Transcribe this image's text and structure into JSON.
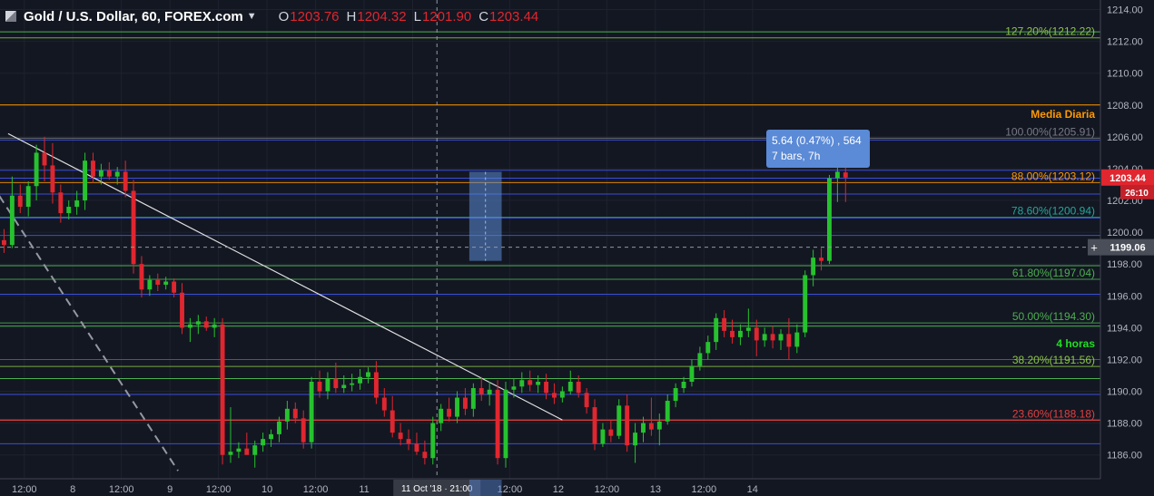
{
  "legend": {
    "symbol": "Gold / U.S. Dollar, 60, FOREX.com",
    "open_key": "O",
    "open": "1203.76",
    "high_key": "H",
    "high": "1204.32",
    "low_key": "L",
    "low": "1201.90",
    "close_key": "C",
    "close": "1203.44"
  },
  "measure_tooltip": {
    "line1": "5.64 (0.47%) , 564",
    "line2": "7 bars, 7h"
  },
  "chart_data": {
    "type": "candlestick",
    "symbol": "Gold / U.S. Dollar",
    "interval": "60",
    "source": "FOREX.com",
    "y_axis": {
      "range": [
        1184.5,
        1214.6
      ],
      "ticks": [
        1186,
        1188,
        1190,
        1192,
        1194,
        1196,
        1198,
        1200,
        1202,
        1204,
        1206,
        1208,
        1210,
        1212,
        1214
      ],
      "labels": [
        "1186.00",
        "1188.00",
        "1190.00",
        "1192.00",
        "1194.00",
        "1196.00",
        "1198.00",
        "1200.00",
        "1202.00",
        "1204.00",
        "1206.00",
        "1208.00",
        "1210.00",
        "1212.00",
        "1214.00"
      ]
    },
    "x_axis": {
      "range": [
        0,
        136
      ],
      "ticks": [
        {
          "x": 3,
          "label": "12:00"
        },
        {
          "x": 9,
          "label": "8"
        },
        {
          "x": 15,
          "label": "12:00"
        },
        {
          "x": 21,
          "label": "9"
        },
        {
          "x": 27,
          "label": "12:00"
        },
        {
          "x": 33,
          "label": "10"
        },
        {
          "x": 39,
          "label": "12:00"
        },
        {
          "x": 45,
          "label": "11"
        },
        {
          "x": 51,
          "label": "12:00"
        },
        {
          "x": 63,
          "label": "12:00"
        },
        {
          "x": 69,
          "label": "12"
        },
        {
          "x": 75,
          "label": "12:00"
        },
        {
          "x": 81,
          "label": "13"
        },
        {
          "x": 87,
          "label": "12:00"
        },
        {
          "x": 93,
          "label": "14"
        }
      ],
      "crosshair_label": "11 Oct '18 · 21:00"
    },
    "fib_levels": [
      {
        "label": "127.20%(1212.22)",
        "price": 1212.22,
        "color": "#8bc34a"
      },
      {
        "label": "100.00%(1205.91)",
        "price": 1205.91,
        "color": "#787b86"
      },
      {
        "label": "88.00%(1203.12)",
        "price": 1203.12,
        "color": "#ff9800"
      },
      {
        "label": "78.60%(1200.94)",
        "price": 1200.94,
        "color": "#26a69a"
      },
      {
        "label": "61.80%(1197.04)",
        "price": 1197.04,
        "color": "#4caf50"
      },
      {
        "label": "50.00%(1194.30)",
        "price": 1194.3,
        "color": "#4caf50"
      },
      {
        "label": "38.20%(1191.56)",
        "price": 1191.56,
        "color": "#8bc34a"
      },
      {
        "label": "23.60%(1188.18)",
        "price": 1188.18,
        "color": "#e04040"
      }
    ],
    "extra_lines": [
      {
        "price": 1212.6,
        "color": "#4caf50"
      },
      {
        "price": 1205.8,
        "color": "#3b4ed8"
      },
      {
        "price": 1203.9,
        "color": "#3b4ed8"
      },
      {
        "price": 1203.4,
        "color": "#3b4ed8"
      },
      {
        "price": 1202.4,
        "color": "#3b4ed8"
      },
      {
        "price": 1200.9,
        "color": "#3b4ed8"
      },
      {
        "price": 1199.8,
        "color": "#3b4ed8"
      },
      {
        "price": 1197.9,
        "color": "#4caf50"
      },
      {
        "price": 1196.1,
        "color": "#3b4ed8"
      },
      {
        "price": 1194.1,
        "color": "#4caf50"
      },
      {
        "price": 1192.0,
        "color": "#3b4ed8"
      },
      {
        "price": 1190.8,
        "color": "#4caf50"
      },
      {
        "price": 1189.8,
        "color": "#3b4ed8"
      },
      {
        "price": 1188.2,
        "color": "#e04040"
      },
      {
        "price": 1186.7,
        "color": "#3b4ed8"
      }
    ],
    "media_diaria": {
      "label": "Media Diaria",
      "price": 1208.0,
      "color": "#ff9800"
    },
    "cuatro_horas": {
      "label": "4 horas",
      "price": 1193.8,
      "color": "#22dd22"
    },
    "trendline": {
      "from": [
        1,
        1206.2
      ],
      "to": [
        69.5,
        1188.2
      ],
      "color": "#e0e0e0"
    },
    "dashed_trendline": {
      "from": [
        -1,
        1203.0
      ],
      "to": [
        22,
        1185.0
      ],
      "color": "#9598a1"
    },
    "measure_box": {
      "from": [
        58,
        1198.2
      ],
      "to": [
        62,
        1203.8
      ]
    },
    "crosshair": {
      "x": 54,
      "price": 1199.06,
      "label": "1199.06"
    },
    "current_price": {
      "price": 1203.44,
      "label": "1203.44",
      "countdown": "26:10"
    },
    "candles": [
      {
        "o": 1199.5,
        "h": 1200.2,
        "l": 1198.7,
        "c": 1199.2
      },
      {
        "o": 1199.2,
        "h": 1203.5,
        "l": 1199.0,
        "c": 1202.3
      },
      {
        "o": 1202.3,
        "h": 1203.0,
        "l": 1201.2,
        "c": 1201.6
      },
      {
        "o": 1201.6,
        "h": 1203.2,
        "l": 1201.0,
        "c": 1202.9
      },
      {
        "o": 1202.9,
        "h": 1205.5,
        "l": 1202.0,
        "c": 1205.0
      },
      {
        "o": 1205.0,
        "h": 1206.0,
        "l": 1203.2,
        "c": 1204.2
      },
      {
        "o": 1204.2,
        "h": 1205.6,
        "l": 1201.8,
        "c": 1202.5
      },
      {
        "o": 1202.5,
        "h": 1203.0,
        "l": 1200.6,
        "c": 1201.2
      },
      {
        "o": 1201.2,
        "h": 1202.0,
        "l": 1200.8,
        "c": 1201.6
      },
      {
        "o": 1201.6,
        "h": 1202.6,
        "l": 1201.1,
        "c": 1202.0
      },
      {
        "o": 1202.0,
        "h": 1205.0,
        "l": 1201.4,
        "c": 1204.5
      },
      {
        "o": 1204.5,
        "h": 1205.0,
        "l": 1203.1,
        "c": 1203.5
      },
      {
        "o": 1203.5,
        "h": 1204.3,
        "l": 1203.0,
        "c": 1203.9
      },
      {
        "o": 1203.9,
        "h": 1204.4,
        "l": 1203.3,
        "c": 1203.5
      },
      {
        "o": 1203.5,
        "h": 1204.1,
        "l": 1203.0,
        "c": 1203.8
      },
      {
        "o": 1203.8,
        "h": 1204.5,
        "l": 1202.2,
        "c": 1202.6
      },
      {
        "o": 1202.6,
        "h": 1203.3,
        "l": 1197.4,
        "c": 1198.0
      },
      {
        "o": 1198.0,
        "h": 1198.5,
        "l": 1195.9,
        "c": 1196.4
      },
      {
        "o": 1196.4,
        "h": 1197.3,
        "l": 1196.0,
        "c": 1197.0
      },
      {
        "o": 1197.0,
        "h": 1197.4,
        "l": 1196.3,
        "c": 1196.7
      },
      {
        "o": 1196.7,
        "h": 1197.2,
        "l": 1196.4,
        "c": 1196.9
      },
      {
        "o": 1196.9,
        "h": 1197.1,
        "l": 1195.9,
        "c": 1196.2
      },
      {
        "o": 1196.2,
        "h": 1196.8,
        "l": 1193.6,
        "c": 1194.0
      },
      {
        "o": 1194.0,
        "h": 1194.6,
        "l": 1193.1,
        "c": 1194.2
      },
      {
        "o": 1194.2,
        "h": 1194.8,
        "l": 1193.6,
        "c": 1194.4
      },
      {
        "o": 1194.4,
        "h": 1194.7,
        "l": 1193.8,
        "c": 1194.0
      },
      {
        "o": 1194.0,
        "h": 1194.6,
        "l": 1193.4,
        "c": 1194.2
      },
      {
        "o": 1194.2,
        "h": 1194.6,
        "l": 1185.4,
        "c": 1186.0
      },
      {
        "o": 1186.0,
        "h": 1189.0,
        "l": 1185.5,
        "c": 1186.2
      },
      {
        "o": 1186.2,
        "h": 1186.8,
        "l": 1185.8,
        "c": 1186.4
      },
      {
        "o": 1186.4,
        "h": 1187.4,
        "l": 1186.0,
        "c": 1186.0
      },
      {
        "o": 1186.0,
        "h": 1186.9,
        "l": 1185.2,
        "c": 1186.6
      },
      {
        "o": 1186.6,
        "h": 1187.4,
        "l": 1186.2,
        "c": 1187.0
      },
      {
        "o": 1187.0,
        "h": 1187.6,
        "l": 1186.5,
        "c": 1187.3
      },
      {
        "o": 1187.3,
        "h": 1188.4,
        "l": 1186.8,
        "c": 1188.1
      },
      {
        "o": 1188.1,
        "h": 1189.4,
        "l": 1187.6,
        "c": 1188.9
      },
      {
        "o": 1188.9,
        "h": 1189.3,
        "l": 1188.0,
        "c": 1188.3
      },
      {
        "o": 1188.3,
        "h": 1188.8,
        "l": 1186.4,
        "c": 1186.8
      },
      {
        "o": 1186.8,
        "h": 1190.9,
        "l": 1186.4,
        "c": 1190.6
      },
      {
        "o": 1190.6,
        "h": 1191.3,
        "l": 1189.6,
        "c": 1190.0
      },
      {
        "o": 1190.0,
        "h": 1191.2,
        "l": 1189.5,
        "c": 1190.8
      },
      {
        "o": 1190.8,
        "h": 1191.8,
        "l": 1189.9,
        "c": 1190.2
      },
      {
        "o": 1190.2,
        "h": 1191.0,
        "l": 1189.9,
        "c": 1190.4
      },
      {
        "o": 1190.4,
        "h": 1191.1,
        "l": 1190.0,
        "c": 1190.5
      },
      {
        "o": 1190.5,
        "h": 1191.4,
        "l": 1190.1,
        "c": 1190.9
      },
      {
        "o": 1190.9,
        "h": 1191.5,
        "l": 1190.5,
        "c": 1191.2
      },
      {
        "o": 1191.2,
        "h": 1191.9,
        "l": 1189.2,
        "c": 1189.6
      },
      {
        "o": 1189.6,
        "h": 1190.2,
        "l": 1188.4,
        "c": 1188.8
      },
      {
        "o": 1188.8,
        "h": 1189.7,
        "l": 1187.1,
        "c": 1187.4
      },
      {
        "o": 1187.4,
        "h": 1188.0,
        "l": 1186.6,
        "c": 1187.0
      },
      {
        "o": 1187.0,
        "h": 1187.6,
        "l": 1186.3,
        "c": 1186.7
      },
      {
        "o": 1186.7,
        "h": 1187.4,
        "l": 1186.0,
        "c": 1186.2
      },
      {
        "o": 1186.2,
        "h": 1186.9,
        "l": 1185.4,
        "c": 1185.8
      },
      {
        "o": 1185.8,
        "h": 1188.4,
        "l": 1185.4,
        "c": 1188.0
      },
      {
        "o": 1188.0,
        "h": 1189.2,
        "l": 1187.5,
        "c": 1188.9
      },
      {
        "o": 1188.9,
        "h": 1189.6,
        "l": 1188.1,
        "c": 1188.4
      },
      {
        "o": 1188.4,
        "h": 1190.0,
        "l": 1188.0,
        "c": 1189.6
      },
      {
        "o": 1189.6,
        "h": 1190.2,
        "l": 1188.5,
        "c": 1188.9
      },
      {
        "o": 1188.9,
        "h": 1190.5,
        "l": 1188.4,
        "c": 1190.2
      },
      {
        "o": 1190.2,
        "h": 1190.9,
        "l": 1189.4,
        "c": 1189.8
      },
      {
        "o": 1189.8,
        "h": 1190.6,
        "l": 1189.1,
        "c": 1190.1
      },
      {
        "o": 1190.1,
        "h": 1190.7,
        "l": 1185.4,
        "c": 1185.8
      },
      {
        "o": 1185.8,
        "h": 1190.6,
        "l": 1185.2,
        "c": 1190.1
      },
      {
        "o": 1190.1,
        "h": 1190.8,
        "l": 1189.6,
        "c": 1190.3
      },
      {
        "o": 1190.3,
        "h": 1191.2,
        "l": 1189.9,
        "c": 1190.7
      },
      {
        "o": 1190.7,
        "h": 1191.3,
        "l": 1190.0,
        "c": 1190.4
      },
      {
        "o": 1190.4,
        "h": 1191.0,
        "l": 1189.9,
        "c": 1190.6
      },
      {
        "o": 1190.6,
        "h": 1191.1,
        "l": 1189.5,
        "c": 1189.9
      },
      {
        "o": 1189.9,
        "h": 1190.5,
        "l": 1189.2,
        "c": 1189.6
      },
      {
        "o": 1189.6,
        "h": 1190.3,
        "l": 1189.3,
        "c": 1190.0
      },
      {
        "o": 1190.0,
        "h": 1191.3,
        "l": 1189.8,
        "c": 1190.6
      },
      {
        "o": 1190.6,
        "h": 1191.0,
        "l": 1189.6,
        "c": 1189.9
      },
      {
        "o": 1189.9,
        "h": 1190.2,
        "l": 1188.6,
        "c": 1189.0
      },
      {
        "o": 1189.0,
        "h": 1189.5,
        "l": 1186.3,
        "c": 1186.7
      },
      {
        "o": 1186.7,
        "h": 1188.0,
        "l": 1186.5,
        "c": 1187.6
      },
      {
        "o": 1187.6,
        "h": 1188.2,
        "l": 1186.8,
        "c": 1187.2
      },
      {
        "o": 1187.2,
        "h": 1189.5,
        "l": 1187.0,
        "c": 1189.1
      },
      {
        "o": 1189.1,
        "h": 1189.8,
        "l": 1186.2,
        "c": 1186.6
      },
      {
        "o": 1186.6,
        "h": 1188.0,
        "l": 1185.5,
        "c": 1187.4
      },
      {
        "o": 1187.4,
        "h": 1188.4,
        "l": 1186.8,
        "c": 1188.0
      },
      {
        "o": 1188.0,
        "h": 1189.6,
        "l": 1187.2,
        "c": 1187.6
      },
      {
        "o": 1187.6,
        "h": 1188.6,
        "l": 1186.6,
        "c": 1188.1
      },
      {
        "o": 1188.1,
        "h": 1189.8,
        "l": 1187.9,
        "c": 1189.4
      },
      {
        "o": 1189.4,
        "h": 1190.5,
        "l": 1189.0,
        "c": 1190.2
      },
      {
        "o": 1190.2,
        "h": 1190.9,
        "l": 1189.9,
        "c": 1190.6
      },
      {
        "o": 1190.6,
        "h": 1192.0,
        "l": 1190.3,
        "c": 1191.6
      },
      {
        "o": 1191.6,
        "h": 1192.8,
        "l": 1191.3,
        "c": 1192.4
      },
      {
        "o": 1192.4,
        "h": 1193.5,
        "l": 1192.0,
        "c": 1193.1
      },
      {
        "o": 1193.1,
        "h": 1194.9,
        "l": 1192.6,
        "c": 1194.6
      },
      {
        "o": 1194.6,
        "h": 1195.1,
        "l": 1193.4,
        "c": 1193.8
      },
      {
        "o": 1193.8,
        "h": 1194.5,
        "l": 1193.0,
        "c": 1193.4
      },
      {
        "o": 1193.4,
        "h": 1194.2,
        "l": 1192.9,
        "c": 1193.8
      },
      {
        "o": 1193.8,
        "h": 1195.2,
        "l": 1193.4,
        "c": 1194.0
      },
      {
        "o": 1194.0,
        "h": 1194.5,
        "l": 1192.2,
        "c": 1193.2
      },
      {
        "o": 1193.2,
        "h": 1194.0,
        "l": 1192.8,
        "c": 1193.6
      },
      {
        "o": 1193.6,
        "h": 1194.1,
        "l": 1192.7,
        "c": 1193.2
      },
      {
        "o": 1193.2,
        "h": 1193.9,
        "l": 1192.6,
        "c": 1193.6
      },
      {
        "o": 1193.6,
        "h": 1194.6,
        "l": 1192.0,
        "c": 1192.8
      },
      {
        "o": 1192.8,
        "h": 1194.2,
        "l": 1192.4,
        "c": 1193.7
      },
      {
        "o": 1193.7,
        "h": 1197.6,
        "l": 1193.4,
        "c": 1197.3
      },
      {
        "o": 1197.3,
        "h": 1198.9,
        "l": 1196.6,
        "c": 1198.4
      },
      {
        "o": 1198.4,
        "h": 1199.0,
        "l": 1197.6,
        "c": 1198.2
      },
      {
        "o": 1198.2,
        "h": 1203.6,
        "l": 1198.0,
        "c": 1203.4
      },
      {
        "o": 1203.4,
        "h": 1204.3,
        "l": 1201.9,
        "c": 1203.8
      },
      {
        "o": 1203.76,
        "h": 1204.32,
        "l": 1201.9,
        "c": 1203.44
      }
    ]
  }
}
